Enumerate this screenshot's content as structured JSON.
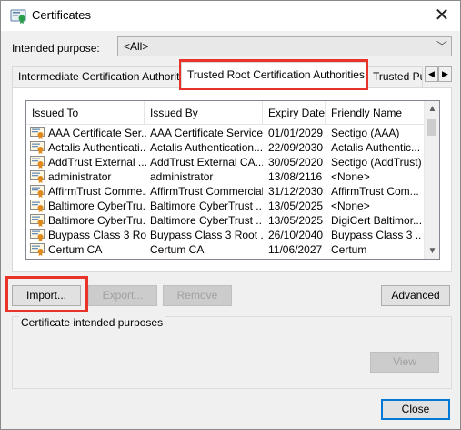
{
  "window": {
    "title": "Certificates",
    "close_glyph": "✕",
    "icon": "certificate-app-icon"
  },
  "purpose": {
    "label": "Intended purpose:",
    "value": "<All>",
    "chevron": "﹀"
  },
  "tabs": [
    {
      "label": "Intermediate Certification Authorities",
      "active": false
    },
    {
      "label": "Trusted Root Certification Authorities",
      "active": true
    },
    {
      "label": "Trusted Publ",
      "active": false
    }
  ],
  "tab_scroll": {
    "left": "◀",
    "right": "▶"
  },
  "table": {
    "columns": [
      "Issued To",
      "Issued By",
      "Expiry Date",
      "Friendly Name"
    ],
    "rows": [
      [
        "AAA Certificate Ser...",
        "AAA Certificate Services",
        "01/01/2029",
        "Sectigo (AAA)"
      ],
      [
        "Actalis Authenticati...",
        "Actalis Authentication...",
        "22/09/2030",
        "Actalis Authentic..."
      ],
      [
        "AddTrust External ...",
        "AddTrust External CA...",
        "30/05/2020",
        "Sectigo (AddTrust)"
      ],
      [
        "administrator",
        "administrator",
        "13/08/2116",
        "<None>"
      ],
      [
        "AffirmTrust Comme...",
        "AffirmTrust Commercial",
        "31/12/2030",
        "AffirmTrust Com..."
      ],
      [
        "Baltimore CyberTru...",
        "Baltimore CyberTrust ...",
        "13/05/2025",
        "<None>"
      ],
      [
        "Baltimore CyberTru...",
        "Baltimore CyberTrust ...",
        "13/05/2025",
        "DigiCert Baltimor..."
      ],
      [
        "Buypass Class 3 Ro...",
        "Buypass Class 3 Root ...",
        "26/10/2040",
        "Buypass Class 3 ..."
      ],
      [
        "Certum CA",
        "Certum CA",
        "11/06/2027",
        "Certum"
      ]
    ],
    "scroll_up": "▲",
    "scroll_down": "▼"
  },
  "buttons": {
    "import": "Import...",
    "export": "Export...",
    "remove": "Remove",
    "advanced": "Advanced",
    "view": "View",
    "close": "Close"
  },
  "group": {
    "label": "Certificate intended purposes"
  },
  "colors": {
    "highlight": "#e8322a",
    "accent": "#0078d7"
  }
}
